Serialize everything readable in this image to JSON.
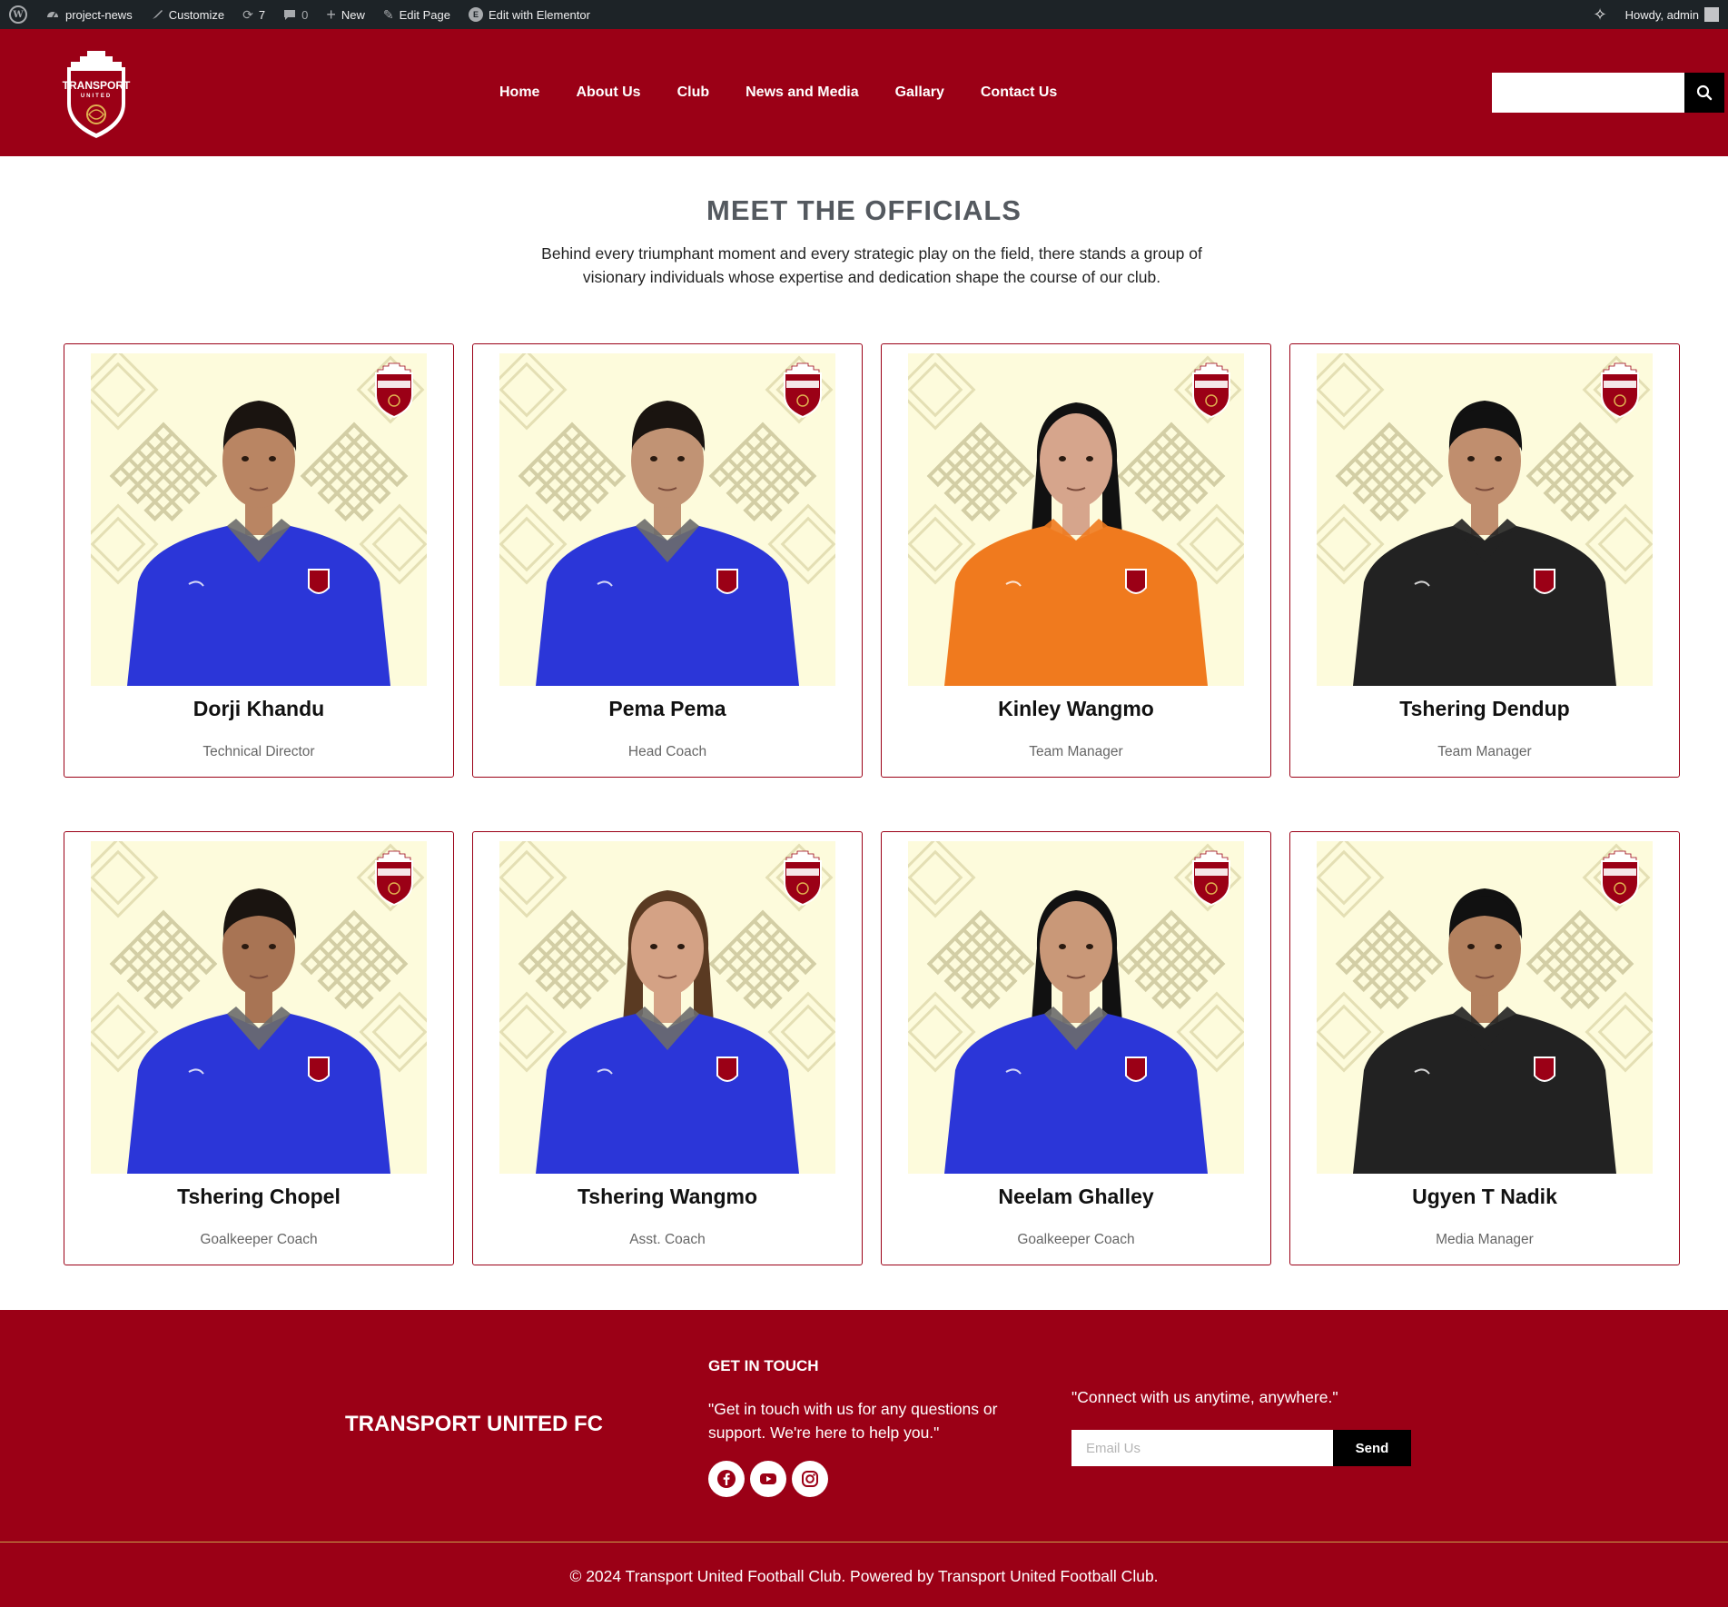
{
  "admin_bar": {
    "site": "project-news",
    "customize": "Customize",
    "updates": "7",
    "comments": "0",
    "new": "New",
    "edit_page": "Edit Page",
    "elementor": "Edit with Elementor",
    "greeting": "Howdy, admin"
  },
  "header": {
    "logo_text": "TRANSPORT",
    "logo_sub": "UNITED",
    "nav": [
      "Home",
      "About Us",
      "Club",
      "News and Media",
      "Gallary",
      "Contact Us"
    ],
    "search_placeholder": ""
  },
  "section": {
    "title": "MEET THE OFFICIALS",
    "subtitle": "Behind every triumphant moment and every strategic play on the field, there stands a group of visionary individuals whose expertise and dedication shape the course of our club."
  },
  "officials": [
    {
      "name": "Dorji Khandu",
      "role": "Technical Director",
      "shirt": "#2b36d8",
      "collar": "#6b6b6b",
      "skin": "#b98563",
      "hair": "#1a1410",
      "gender": "m"
    },
    {
      "name": "Pema Pema",
      "role": "Head Coach",
      "shirt": "#2b36d8",
      "collar": "#6b6b6b",
      "skin": "#c19374",
      "hair": "#1a1410",
      "gender": "m"
    },
    {
      "name": "Kinley Wangmo",
      "role": "Team Manager",
      "shirt": "#f07a1e",
      "collar": "#f07a1e",
      "skin": "#d6a58c",
      "hair": "#111111",
      "gender": "f"
    },
    {
      "name": "Tshering Dendup",
      "role": "Team Manager",
      "shirt": "#222222",
      "collar": "#222222",
      "skin": "#c08e6e",
      "hair": "#111111",
      "gender": "m"
    },
    {
      "name": "Tshering Chopel",
      "role": "Goalkeeper Coach",
      "shirt": "#2b36d8",
      "collar": "#6b6b6b",
      "skin": "#a87454",
      "hair": "#1a1410",
      "gender": "m"
    },
    {
      "name": "Tshering Wangmo",
      "role": "Asst. Coach",
      "shirt": "#2b36d8",
      "collar": "#6b6b6b",
      "skin": "#d4a285",
      "hair": "#5a3a22",
      "gender": "f"
    },
    {
      "name": "Neelam Ghalley",
      "role": "Goalkeeper Coach",
      "shirt": "#2b36d8",
      "collar": "#6b6b6b",
      "skin": "#c99878",
      "hair": "#111111",
      "gender": "f"
    },
    {
      "name": "Ugyen T Nadik",
      "role": "Media Manager",
      "shirt": "#222222",
      "collar": "#222222",
      "skin": "#b3815f",
      "hair": "#111111",
      "gender": "m"
    }
  ],
  "footer": {
    "brand": "TRANSPORT UNITED FC",
    "get_in_touch": "GET IN TOUCH",
    "touch_text": "\"Get in touch with us for any questions or support. We're here to help you.\"",
    "connect": "\"Connect with us anytime, anywhere.\"",
    "email_placeholder": "Email Us",
    "send": "Send",
    "copyright": "© 2024 Transport United Football Club. Powered by Transport United Football Club."
  },
  "colors": {
    "brand": "#9b0016",
    "admin_bar": "#1d2327",
    "photo_bg": "#fdfbdc"
  }
}
